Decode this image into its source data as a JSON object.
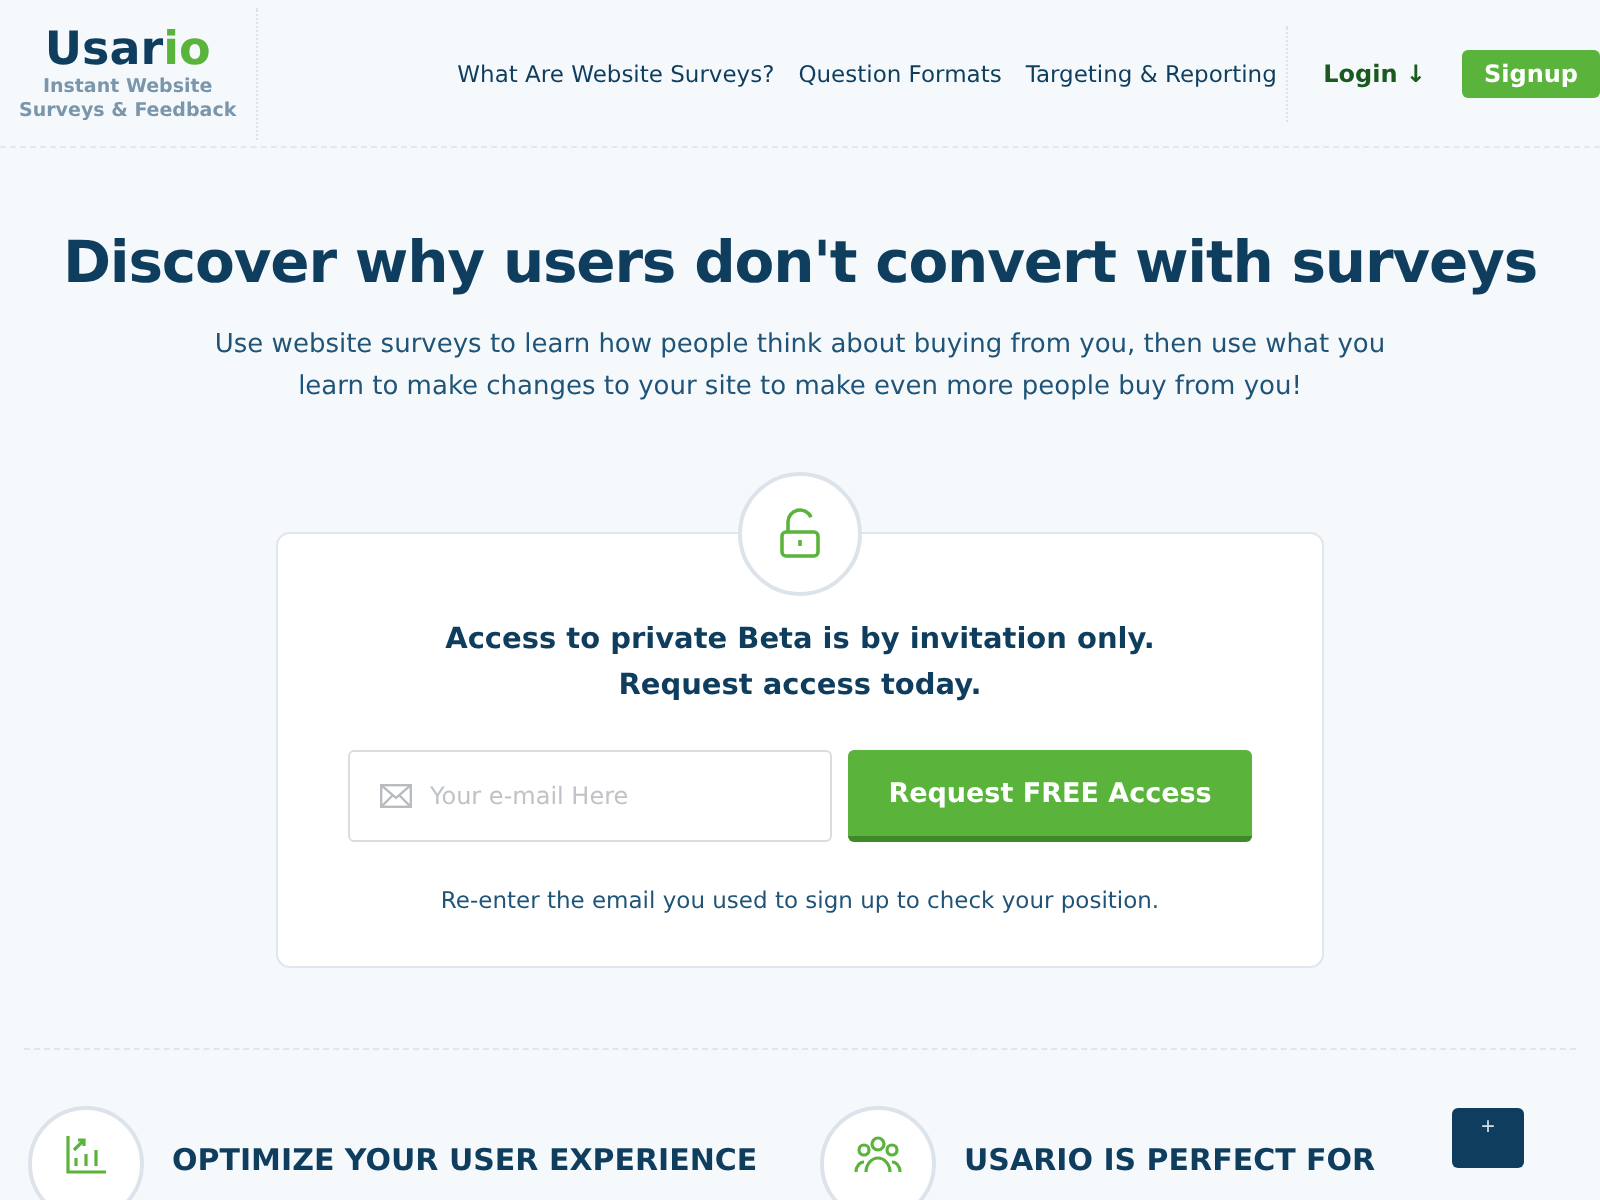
{
  "header": {
    "logo": {
      "name_main": "Usar",
      "name_accent": "io",
      "tagline_1": "Instant Website",
      "tagline_2": "Surveys & Feedback"
    },
    "nav": [
      "What Are Website Surveys?",
      "Question Formats",
      "Targeting & Reporting"
    ],
    "login": "Login ↓",
    "signup": "Signup"
  },
  "hero": {
    "title": "Discover why users don't convert with surveys",
    "subtitle": "Use website surveys to learn how people think about buying from you, then use what you learn to make changes to your site to make even more people buy from you!"
  },
  "card": {
    "heading_1": "Access to private Beta is by invitation only.",
    "heading_2": "Request access today.",
    "email": {
      "placeholder": "Your e-mail Here"
    },
    "button": "Request FREE Access",
    "note": "Re-enter the email you used to sign up to check your position."
  },
  "features": [
    {
      "kind": "chart",
      "title": "OPTIMIZE YOUR USER EXPERIENCE"
    },
    {
      "kind": "people",
      "title": "USARIO IS PERFECT FOR"
    }
  ],
  "help_button": "+"
}
